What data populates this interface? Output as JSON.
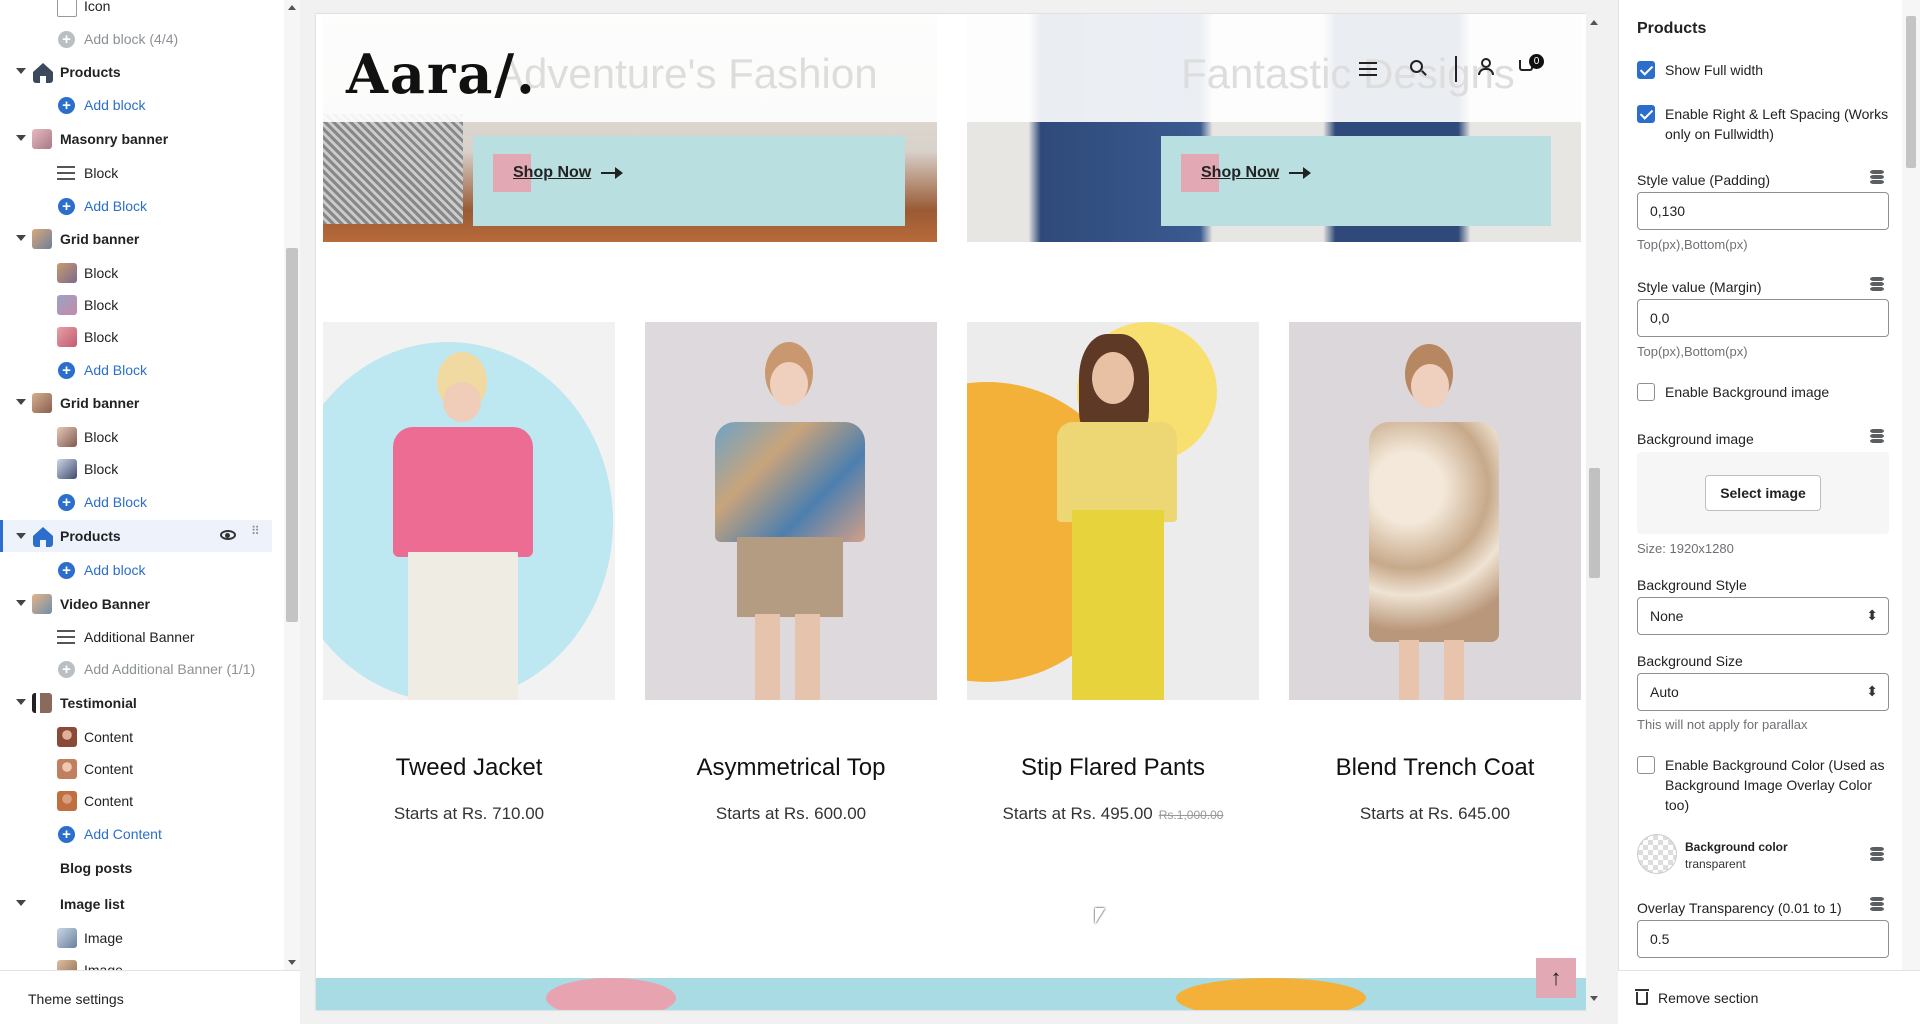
{
  "sidebar": {
    "items": [
      {
        "type": "block",
        "label": "Icon"
      },
      {
        "type": "add-disabled",
        "label": "Add block (4/4)"
      },
      {
        "type": "section",
        "label": "Products"
      },
      {
        "type": "add",
        "label": "Add block"
      },
      {
        "type": "section",
        "label": "Masonry banner"
      },
      {
        "type": "block",
        "label": "Block"
      },
      {
        "type": "add",
        "label": "Add Block"
      },
      {
        "type": "section",
        "label": "Grid banner"
      },
      {
        "type": "block",
        "label": "Block"
      },
      {
        "type": "block",
        "label": "Block"
      },
      {
        "type": "block",
        "label": "Block"
      },
      {
        "type": "add",
        "label": "Add Block"
      },
      {
        "type": "section",
        "label": "Grid banner"
      },
      {
        "type": "block",
        "label": "Block"
      },
      {
        "type": "block",
        "label": "Block"
      },
      {
        "type": "add",
        "label": "Add Block"
      },
      {
        "type": "section-selected",
        "label": "Products"
      },
      {
        "type": "add",
        "label": "Add block"
      },
      {
        "type": "section",
        "label": "Video Banner"
      },
      {
        "type": "block",
        "label": "Additional Banner"
      },
      {
        "type": "add-disabled",
        "label": "Add Additional Banner (1/1)"
      },
      {
        "type": "section",
        "label": "Testimonial"
      },
      {
        "type": "block",
        "label": "Content"
      },
      {
        "type": "block",
        "label": "Content"
      },
      {
        "type": "block",
        "label": "Content"
      },
      {
        "type": "add",
        "label": "Add Content"
      },
      {
        "type": "section",
        "label": "Blog posts"
      },
      {
        "type": "section",
        "label": "Image list"
      },
      {
        "type": "block",
        "label": "Image"
      },
      {
        "type": "block",
        "label": "Image"
      }
    ],
    "theme_settings": "Theme settings"
  },
  "preview": {
    "logo": "Aara/.",
    "cart_count": "0",
    "banners": [
      {
        "ghost_title": "Adventure's Fashion",
        "cta": "Shop Now"
      },
      {
        "ghost_title": "Fantastic Designs",
        "cta": "Shop Now"
      }
    ],
    "products": [
      {
        "name": "Tweed Jacket",
        "price": "Starts at Rs. 710.00",
        "compare": ""
      },
      {
        "name": "Asymmetrical Top",
        "price": "Starts at Rs. 600.00",
        "compare": ""
      },
      {
        "name": "Stip Flared Pants",
        "price": "Starts at Rs. 495.00",
        "compare": "Rs.1,000.00"
      },
      {
        "name": "Blend Trench Coat",
        "price": "Starts at Rs. 645.00",
        "compare": ""
      }
    ]
  },
  "settings": {
    "title": "Products",
    "show_full_width": "Show Full width",
    "enable_spacing": "Enable Right & Left Spacing (Works only on Fullwidth)",
    "padding_label": "Style value (Padding)",
    "padding_value": "0,130",
    "padding_hint": "Top(px),Bottom(px)",
    "margin_label": "Style value (Margin)",
    "margin_value": "0,0",
    "margin_hint": "Top(px),Bottom(px)",
    "enable_bg_image": "Enable Background image",
    "bg_image_label": "Background image",
    "select_image": "Select image",
    "size_hint": "Size: 1920x1280",
    "bg_style_label": "Background Style",
    "bg_style_value": "None",
    "bg_size_label": "Background Size",
    "bg_size_value": "Auto",
    "parallax_hint": "This will not apply for parallax",
    "enable_bg_color": "Enable Background Color (Used as Background Image Overlay Color too)",
    "bg_color_label": "Background color",
    "bg_color_value": "transparent",
    "overlay_label": "Overlay Transparency (0.01 to 1)",
    "overlay_value": "0.5",
    "remove_section": "Remove section"
  },
  "colors": {
    "accent": "#2c6ecb",
    "cta_bg": "#b9dfe0",
    "cta_pink": "#e2a8b4"
  }
}
